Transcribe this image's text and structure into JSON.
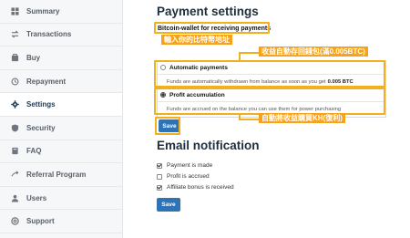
{
  "sidebar": {
    "items": [
      {
        "label": "Summary",
        "icon": "dashboard-icon"
      },
      {
        "label": "Transactions",
        "icon": "transactions-icon"
      },
      {
        "label": "Buy",
        "icon": "cart-icon"
      },
      {
        "label": "Repayment",
        "icon": "history-icon"
      },
      {
        "label": "Settings",
        "icon": "gear-icon",
        "active": true
      },
      {
        "label": "Security",
        "icon": "shield-icon"
      },
      {
        "label": "FAQ",
        "icon": "book-icon"
      },
      {
        "label": "Referral Program",
        "icon": "referral-icon"
      },
      {
        "label": "Users",
        "icon": "users-icon"
      },
      {
        "label": "Support",
        "icon": "support-icon"
      }
    ]
  },
  "payment": {
    "title": "Payment settings",
    "address_label": "Bitcoin-wallet for receiving payments",
    "automatic": {
      "label": "Automatic payments",
      "desc_prefix": "Funds are automatically withdrawn from balance as soon as you get",
      "desc_amount": "0.005 BTC",
      "selected": false
    },
    "profit": {
      "label": "Profit accumulation",
      "desc": "Funds are accrued on the balance you can use them for power purchasing",
      "selected": true
    },
    "save_label": "Save"
  },
  "email": {
    "title": "Email notification",
    "options": [
      {
        "label": "Payment is made",
        "checked": true
      },
      {
        "label": "Profit is accrued",
        "checked": false
      },
      {
        "label": "Affiliate bonus is received",
        "checked": true
      }
    ],
    "save_label": "Save"
  },
  "annotations": {
    "address_note": "輸入你的比特幣地址",
    "auto_note": "收益自動存回錢包(滿0.005BTC)",
    "profit_note": "自動將收益購買KH(復利)"
  },
  "colors": {
    "accent": "#2f73b7",
    "annotation": "#f6a21b",
    "sidebar_bg": "#f6f7f8"
  }
}
